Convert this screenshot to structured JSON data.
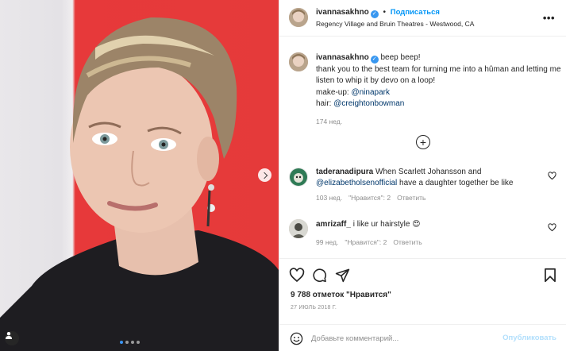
{
  "post": {
    "username": "ivannasakhno",
    "verified_mark": "✓",
    "follow_label": "Подписаться",
    "bullet": "•",
    "location": "Regency Village and Bruin Theatres - Westwood, CA",
    "more_label": "•••"
  },
  "caption": {
    "username": "ivannasakhno",
    "line1": "beep beep!",
    "line2": "thank you to the best team for turning me into a hûman and letting me listen to whip it by devo on a loop!",
    "makeup_label": "make-up:",
    "makeup_handle": "@ninapark",
    "hair_label": "hair:",
    "hair_handle": "@creightonbowman",
    "time": "174 нед."
  },
  "load_more_icon": "plus-circle-icon",
  "comments": [
    {
      "username": "taderanadipura",
      "text_before": "When Scarlett Johansson and",
      "mention": "@elizabetholsenofficial",
      "text_after": "have a daughter together be like",
      "time": "103 нед.",
      "likes": "\"Нравится\": 2",
      "reply": "Ответить"
    },
    {
      "username": "amrizaff_",
      "text": "i like ur hairstyle",
      "emoji": "😍",
      "time": "99 нед.",
      "likes": "\"Нравится\": 2",
      "reply": "Ответить"
    }
  ],
  "stats": {
    "likes": "9 788 отметок \"Нравится\"",
    "date": "27 ИЮЛЬ 2018 Г."
  },
  "add_comment": {
    "placeholder": "Добавьте комментарий...",
    "post_label": "Опубликовать"
  },
  "colors": {
    "accent": "#0095f6",
    "verified": "#3897f0",
    "background_red": "#e53a3a",
    "text": "#262626",
    "muted": "#8e8e8e"
  }
}
